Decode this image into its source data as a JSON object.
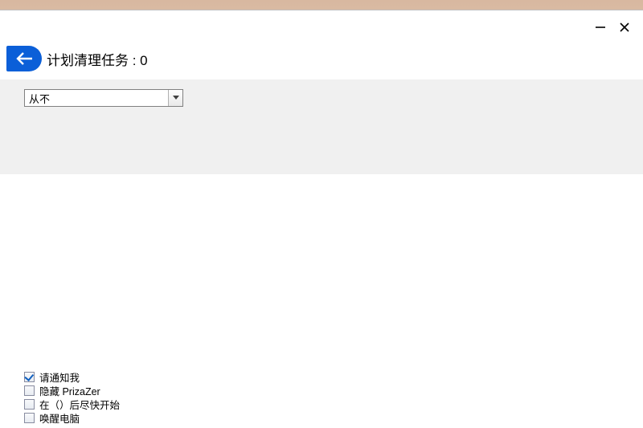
{
  "header": {
    "title": "计划清理任务 : 0"
  },
  "schedule": {
    "selected": "从不"
  },
  "options": [
    {
      "label": "请通知我",
      "checked": true
    },
    {
      "label": "隐藏 PrizaZer",
      "checked": false
    },
    {
      "label": "在（）后尽快开始",
      "checked": false
    },
    {
      "label": "唤醒电脑",
      "checked": false
    }
  ]
}
